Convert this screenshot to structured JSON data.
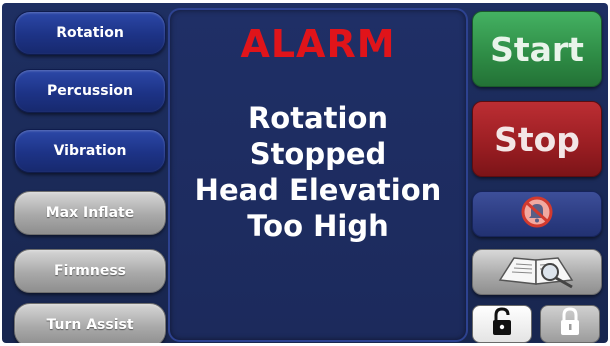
{
  "left_buttons": [
    {
      "label": "Rotation",
      "style": "blue"
    },
    {
      "label": "Percussion",
      "style": "blue"
    },
    {
      "label": "Vibration",
      "style": "blue"
    },
    {
      "label": "Max Inflate",
      "style": "grey"
    },
    {
      "label": "Firmness",
      "style": "grey"
    },
    {
      "label": "Turn Assist",
      "style": "grey"
    }
  ],
  "alarm": {
    "title": "ALARM",
    "message_lines": [
      "Rotation",
      "Stopped",
      "Head Elevation",
      "Too High"
    ]
  },
  "right_buttons": {
    "start_label": "Start",
    "stop_label": "Stop",
    "silence_icon": "alarm-silence-icon",
    "manual_icon": "manual-book-icon",
    "unlock_icon": "padlock-open-icon",
    "lock_icon": "padlock-closed-icon"
  },
  "colors": {
    "background": "#1e2f62",
    "alarm_title": "#e0141a",
    "start": "#2e8b45",
    "stop": "#991d22",
    "mode_button": "#1d3386",
    "secondary_button": "#a9a9a9"
  }
}
